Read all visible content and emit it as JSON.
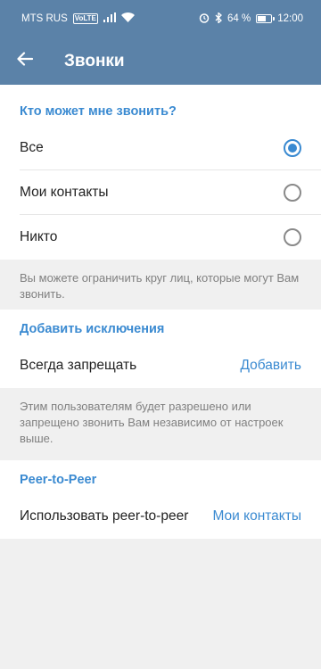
{
  "status_bar": {
    "carrier": "MTS RUS",
    "network_badge": "VoLTE",
    "battery_percent": "64 %",
    "battery_level": 0.64,
    "time": "12:00"
  },
  "app_bar": {
    "title": "Звонки",
    "back_icon": "arrow-left-icon"
  },
  "who_can_call": {
    "header": "Кто может мне звонить?",
    "options": [
      {
        "label": "Все",
        "selected": true
      },
      {
        "label": "Мои контакты",
        "selected": false
      },
      {
        "label": "Никто",
        "selected": false
      }
    ],
    "info": "Вы можете ограничить круг лиц, которые могут Вам звонить."
  },
  "exceptions": {
    "header": "Добавить исключения",
    "row_label": "Всегда запрещать",
    "row_action": "Добавить",
    "info": "Этим пользователям будет разрешено или запрещено звонить Вам независимо от настроек выше."
  },
  "p2p": {
    "header": "Peer-to-Peer",
    "row_label": "Использовать peer-to-peer",
    "row_value": "Мои контакты"
  },
  "colors": {
    "app_bar": "#5b82a8",
    "accent": "#3a8ad1",
    "background": "#f0f0f0"
  }
}
